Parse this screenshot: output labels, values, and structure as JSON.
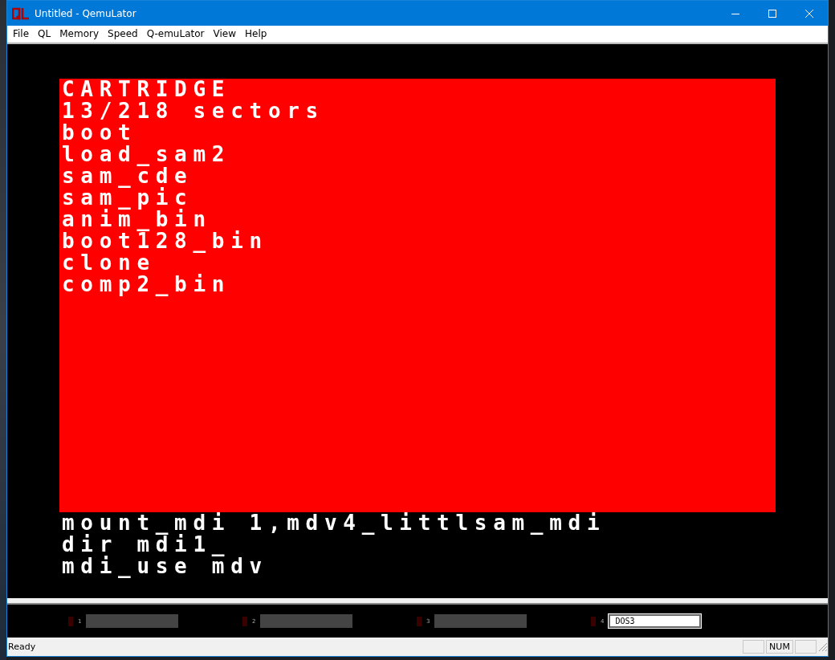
{
  "window": {
    "title": "Untitled - QemuLator"
  },
  "menu": [
    "File",
    "QL",
    "Memory",
    "Speed",
    "Q-emuLator",
    "View",
    "Help"
  ],
  "screen": {
    "window_lines": [
      "CARTRIDGE",
      "13/218 sectors",
      "boot",
      "load_sam2",
      "sam_cde",
      "sam_pic",
      "anim_bin",
      "boot128_bin",
      "clone",
      "comp2_bin"
    ],
    "command_lines": [
      "mount_mdi 1,mdv4_littlsam_mdi",
      "dir mdi1_",
      "mdi_use mdv"
    ]
  },
  "drives": [
    {
      "number": "1",
      "loaded": false
    },
    {
      "number": "2",
      "loaded": false
    },
    {
      "number": "3",
      "loaded": false
    },
    {
      "number": "4",
      "loaded": true,
      "name": "DOS3"
    }
  ],
  "status_bar": {
    "text": "Ready",
    "indicator": "NUM"
  }
}
